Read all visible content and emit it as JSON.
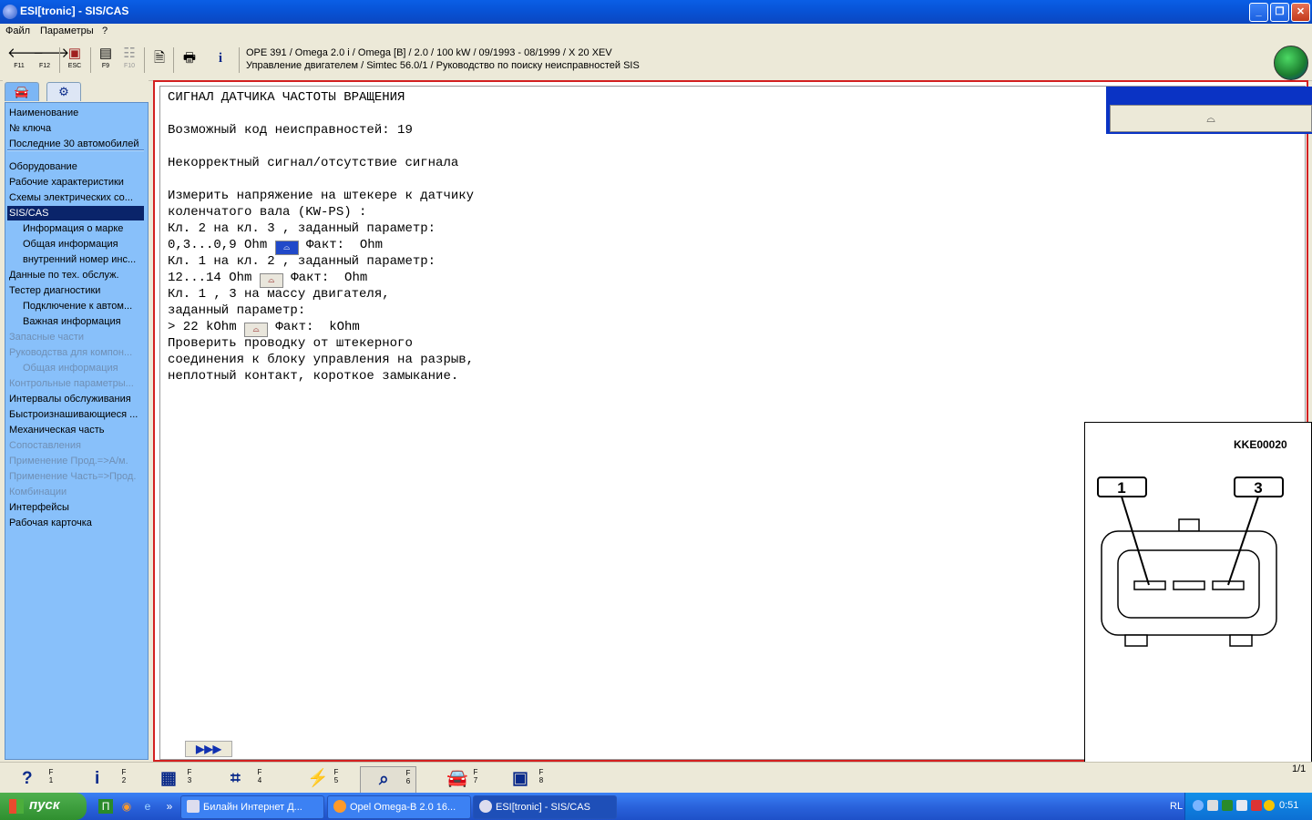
{
  "window": {
    "title": "ESI[tronic] - SIS/CAS",
    "buttons": {
      "minimize": "_",
      "restore": "❐",
      "close": "✕"
    }
  },
  "menu": {
    "file": "Файл",
    "params": "Параметры",
    "help": "?"
  },
  "toolbar": {
    "back_key": "F11",
    "forward_key": "F12",
    "esc_key": "ESC",
    "f9_key": "F9",
    "f10_key": "F10",
    "vehicle_line": "OPE 391 / Omega 2.0 i / Omega [B] / 2.0 / 100 kW / 09/1993 - 08/1999 / X 20 XEV",
    "system_line": "Управление двигателем / Simtec 56.0/1 / Руководство по поиску неисправностей SIS"
  },
  "sidebar": {
    "items": [
      {
        "label": "Наименование",
        "state": "normal"
      },
      {
        "label": "№ ключа",
        "state": "normal"
      },
      {
        "label": "Последние 30 автомобилей",
        "state": "normal"
      },
      {
        "label": "Оборудование",
        "state": "normal"
      },
      {
        "label": "Рабочие характеристики",
        "state": "normal"
      },
      {
        "label": "Схемы электрических со...",
        "state": "normal"
      },
      {
        "label": "SIS/CAS",
        "state": "selected"
      },
      {
        "label": "Информация о марке",
        "state": "sub"
      },
      {
        "label": "Общая информация",
        "state": "sub"
      },
      {
        "label": "внутренний номер инс...",
        "state": "sub"
      },
      {
        "label": "Данные по тех. обслуж.",
        "state": "normal"
      },
      {
        "label": "Тестер диагностики",
        "state": "normal"
      },
      {
        "label": "Подключение к автом...",
        "state": "sub"
      },
      {
        "label": "Важная информация",
        "state": "sub"
      },
      {
        "label": "Запасные части",
        "state": "disabled"
      },
      {
        "label": "Руководства для компон...",
        "state": "disabled"
      },
      {
        "label": "Общая информация",
        "state": "sub-disabled"
      },
      {
        "label": "Контрольные параметры...",
        "state": "disabled"
      },
      {
        "label": "Интервалы обслуживания",
        "state": "normal"
      },
      {
        "label": "Быстроизнашивающиеся ...",
        "state": "normal"
      },
      {
        "label": "Механическая часть",
        "state": "normal"
      },
      {
        "label": "Сопоставления",
        "state": "disabled"
      },
      {
        "label": "Применение Прод.=>А/м.",
        "state": "disabled"
      },
      {
        "label": "Применение Часть=>Прод.",
        "state": "disabled"
      },
      {
        "label": "Комбинации",
        "state": "disabled"
      },
      {
        "label": "Интерфейсы",
        "state": "normal"
      },
      {
        "label": "Рабочая карточка",
        "state": "normal"
      }
    ]
  },
  "content": {
    "lines": [
      "СИГНАЛ ДАТЧИКА ЧАСТОТЫ ВРАЩЕНИЯ",
      "",
      "Возможный код неисправностей: 19",
      "",
      "Некорректный сигнал/отсутствие сигнала",
      "",
      "Измерить напряжение на штекере к датчику",
      "коленчатого вала (KW-PS) :",
      "Кл. 2 на кл. 3 , заданный параметр:",
      "0,3...0,9 Ohm {M1} Факт:  Ohm",
      "Кл. 1 на кл. 2 , заданный параметр:",
      "12...14 Ohm {M2} Факт:  Ohm",
      "Кл. 1 , 3 на массу двигателя,",
      "заданный параметр:",
      "> 22 kOhm {M3} Факт:  kOhm",
      "Проверить проводку от штекерного",
      "соединения к блоку управления на разрыв,",
      "неплотный контакт, короткое замыкание."
    ],
    "next_label": "▶▶▶",
    "diagram": {
      "code": "KKE00020",
      "pin_left": "1",
      "pin_right": "3"
    }
  },
  "function_keys": [
    {
      "icon": "help-icon",
      "key_top": "F",
      "key_bottom": "1"
    },
    {
      "icon": "info-icon",
      "key_top": "F",
      "key_bottom": "2"
    },
    {
      "icon": "components-icon",
      "key_top": "F",
      "key_bottom": "3"
    },
    {
      "icon": "wiring-icon",
      "key_top": "F",
      "key_bottom": "4"
    },
    {
      "icon": "tester-icon",
      "key_top": "F",
      "key_bottom": "5"
    },
    {
      "icon": "zoom-icon",
      "key_top": "F",
      "key_bottom": "6"
    },
    {
      "icon": "car-icon",
      "key_top": "F",
      "key_bottom": "7"
    },
    {
      "icon": "esi-kts-icon",
      "key_top": "F",
      "key_bottom": "8"
    }
  ],
  "pager": "1/1",
  "taskbar": {
    "start": "пуск",
    "tasks": [
      {
        "label": "Билайн Интернет Д..."
      },
      {
        "label": "Opel Omega-B 2.0 16..."
      },
      {
        "label": "ESI[tronic] - SIS/CAS"
      }
    ],
    "lang": "RL",
    "clock": "0:51"
  }
}
